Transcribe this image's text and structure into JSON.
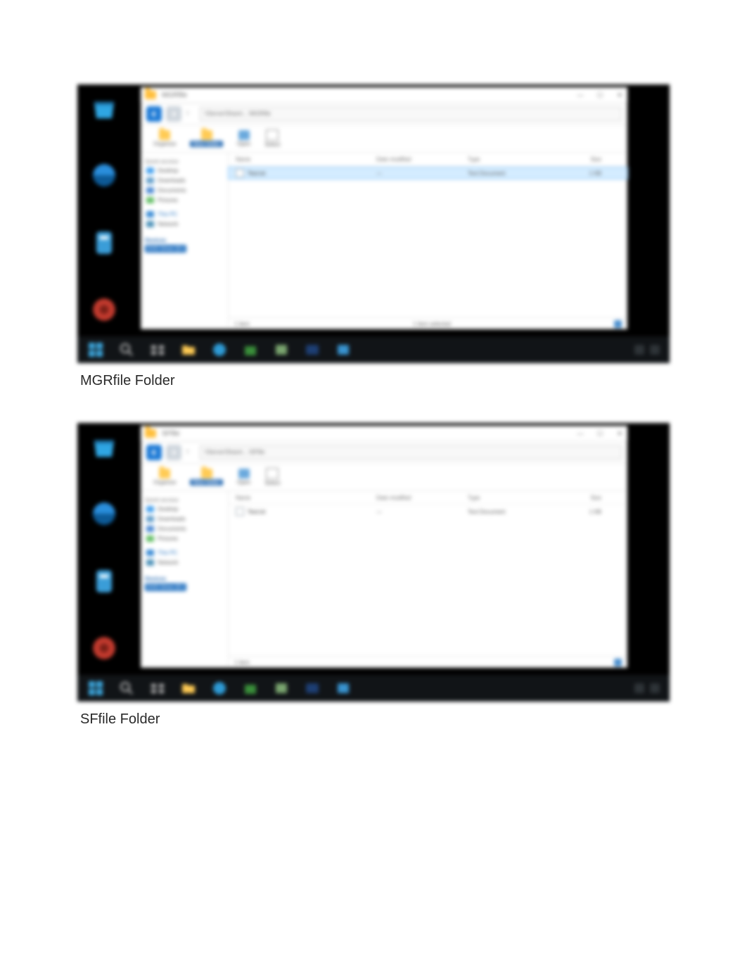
{
  "captions": {
    "fig1": "MGRfile Folder",
    "fig2": "SFfile Folder"
  },
  "screenshots": [
    {
      "id": "mgr",
      "window_title": "MGRfile",
      "address_path": "\\\\Server\\Share\\... \\MGRfile",
      "row_selected": true,
      "file": {
        "name": "Test.txt",
        "date": "—",
        "type": "Text Document",
        "size": "1 KB"
      },
      "status_left": "1 item",
      "status_center": "1 item selected"
    },
    {
      "id": "sf",
      "window_title": "SFfile",
      "address_path": "\\\\Server\\Share\\... \\SFfile",
      "row_selected": false,
      "file": {
        "name": "Test.txt",
        "date": "—",
        "type": "Text Document",
        "size": "1 KB"
      },
      "status_left": "1 item",
      "status_center": ""
    }
  ],
  "columns": {
    "name": "Name",
    "date": "Date modified",
    "type": "Type",
    "size": "Size"
  },
  "ribbon": {
    "organize": "Organize",
    "new": "New folder",
    "open": "Open",
    "select": "Select"
  },
  "navpane": {
    "quick": "Quick access",
    "desktop": "Desktop",
    "downloads": "Downloads",
    "documents": "Documents",
    "pictures": "Pictures",
    "thispc": "This PC",
    "network": "Network",
    "device_title": "Devices",
    "device_sub": "DVD Drive (D:)"
  },
  "window_controls": {
    "min": "—",
    "max": "☐",
    "close": "✕"
  },
  "dock_names": [
    "recycle-bin-icon",
    "browser-icon",
    "utility-icon",
    "media-icon"
  ],
  "task_names": [
    "start-icon",
    "search-icon",
    "task-view-icon",
    "file-explorer-icon",
    "edge-icon",
    "store-icon",
    "server-manager-icon",
    "powershell-icon",
    "app-icon"
  ],
  "tray": {
    "time": "",
    "date": ""
  }
}
